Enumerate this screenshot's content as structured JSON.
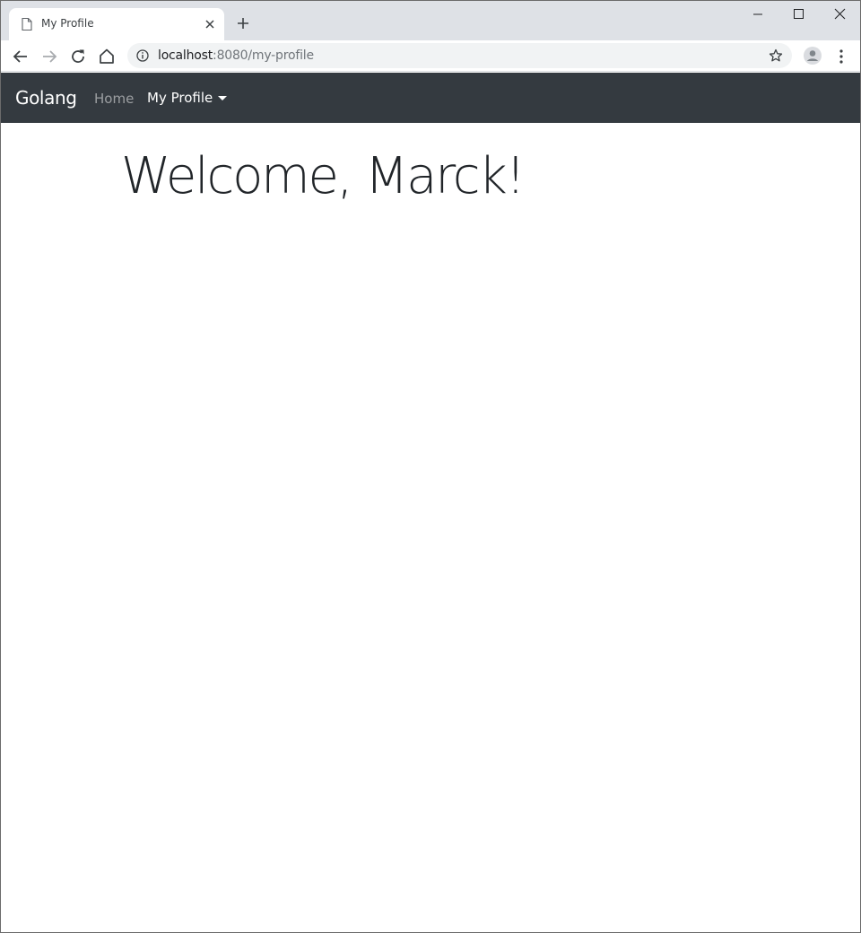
{
  "browser": {
    "tab": {
      "title": "My Profile",
      "icon": "page-icon"
    },
    "omnibox": {
      "host": "localhost",
      "rest": ":8080/my-profile"
    }
  },
  "navbar": {
    "brand": "Golang",
    "items": [
      {
        "label": "Home",
        "active": false
      },
      {
        "label": "My Profile",
        "active": true,
        "dropdown": true
      }
    ],
    "background": "#343a40"
  },
  "main": {
    "heading": "Welcome, Marck!"
  }
}
